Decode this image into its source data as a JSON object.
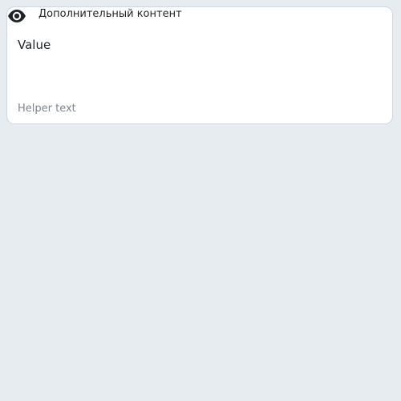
{
  "field": {
    "additional_content": {
      "icon": "eye-icon",
      "label": "Дополнительный контент"
    },
    "value": "Value",
    "helper_text": "Helper text"
  },
  "colors": {
    "background": "#e7ecf0",
    "card_background": "#ffffff",
    "card_border": "#cfd8e1",
    "text_primary": "#20252b",
    "text_helper": "#7c858d"
  }
}
